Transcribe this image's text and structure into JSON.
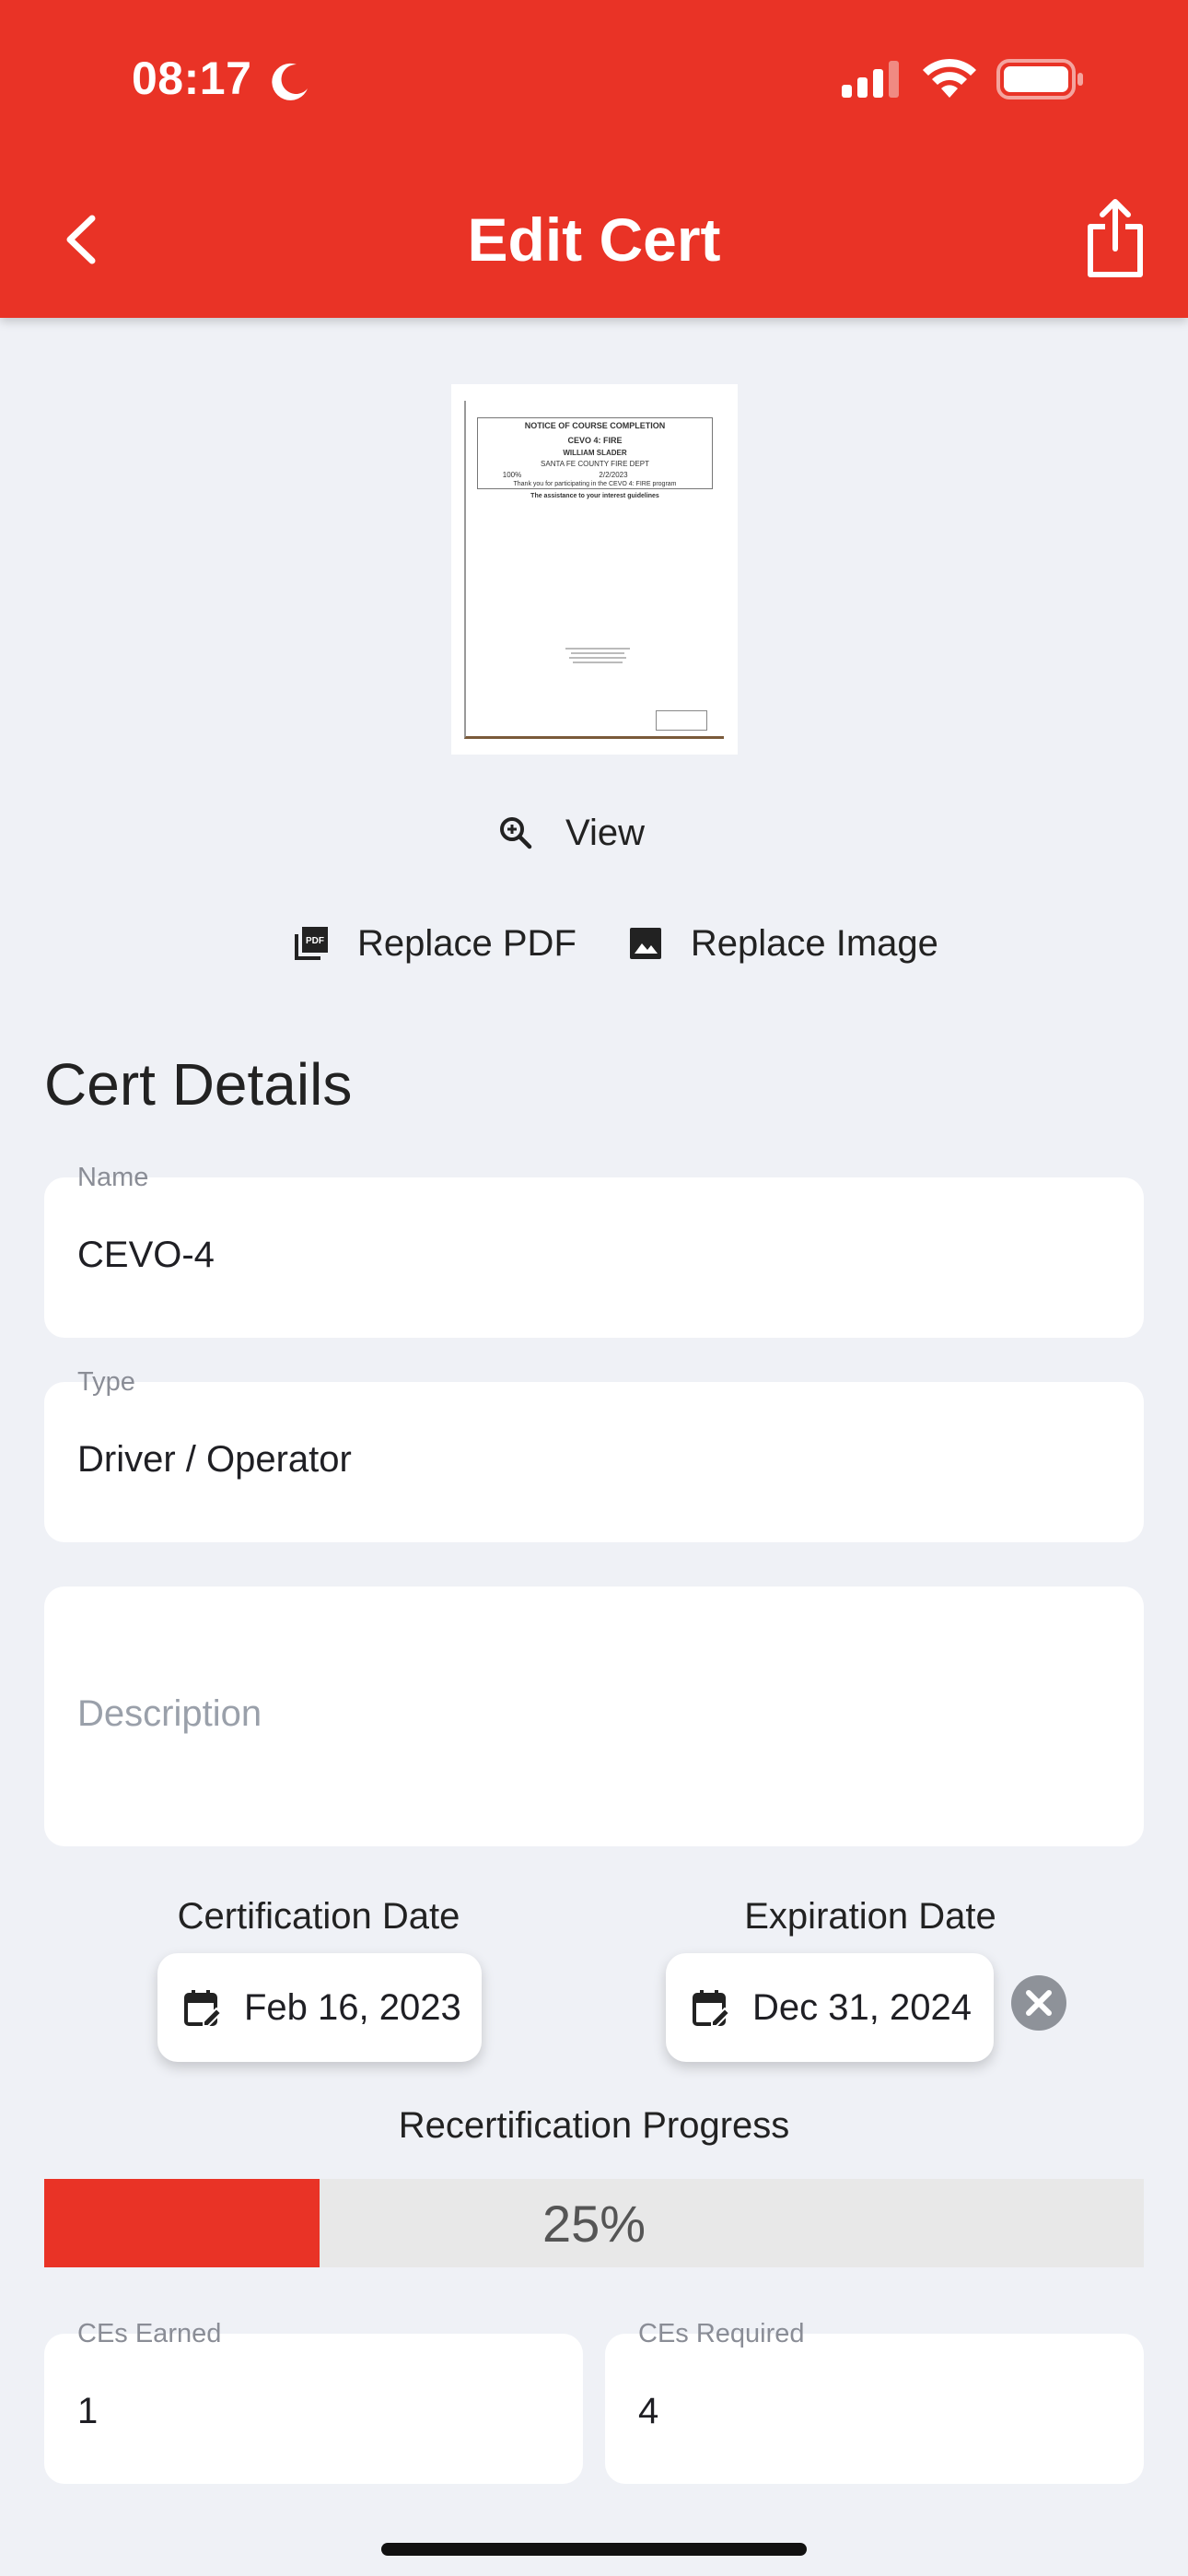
{
  "status_bar": {
    "time": "08:17"
  },
  "header": {
    "title": "Edit Cert"
  },
  "document_preview": {
    "line1": "NOTICE OF COURSE COMPLETION",
    "line2": "CEVO 4: FIRE",
    "line3": "WILLIAM SLADER",
    "line4": "SANTA FE COUNTY FIRE DEPT",
    "line5": "100%",
    "line6": "2/2/2023",
    "line7": "Thank you for participating in the CEVO 4: FIRE program",
    "line8": "The assistance to your interest guidelines"
  },
  "actions": {
    "view": "View",
    "replace_pdf": "Replace PDF",
    "replace_image": "Replace Image"
  },
  "section_title": "Cert Details",
  "fields": {
    "name": {
      "label": "Name",
      "value": "CEVO-4"
    },
    "type": {
      "label": "Type",
      "value": "Driver / Operator"
    },
    "description": {
      "placeholder": "Description"
    }
  },
  "dates": {
    "certification": {
      "label": "Certification Date",
      "value": "Feb 16, 2023"
    },
    "expiration": {
      "label": "Expiration Date",
      "value": "Dec 31, 2024"
    }
  },
  "progress": {
    "label": "Recertification Progress",
    "fraction": 0.25,
    "text": "25%"
  },
  "ces": {
    "earned": {
      "label": "CEs Earned",
      "value": "1"
    },
    "required": {
      "label": "CEs Required",
      "value": "4"
    }
  },
  "colors": {
    "accent": "#e93326",
    "background": "#eff1f6"
  }
}
